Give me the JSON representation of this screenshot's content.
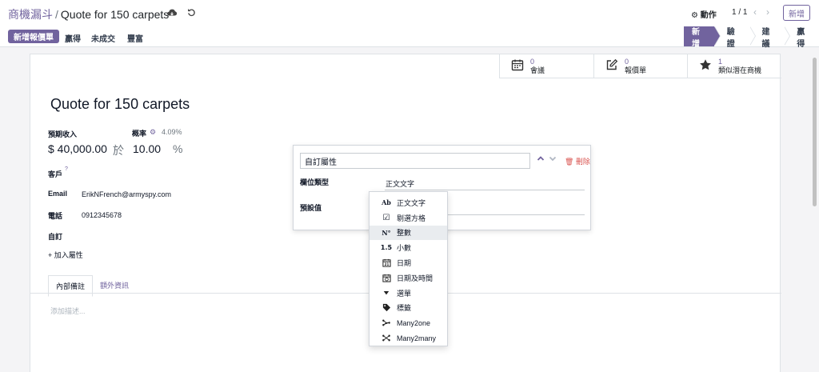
{
  "breadcrumb": {
    "parent": "商機漏斗",
    "separator": "/",
    "current": "Quote for 150 carpets"
  },
  "topbar": {
    "action": "⚙ 動作",
    "pager": "1 / 1",
    "new_label": "新增"
  },
  "control": {
    "new_quote": "新增報價單",
    "buttons": [
      "贏得",
      "未成交",
      "豐富"
    ],
    "stages": [
      "新增",
      "驗證",
      "建議",
      "贏得"
    ]
  },
  "smart_buttons": [
    {
      "value": "0",
      "label": "會議",
      "icon": "calendar-icon"
    },
    {
      "value": "0",
      "label": "報價單",
      "icon": "pencil-square-icon"
    },
    {
      "value": "1",
      "label": "類似潛在商機",
      "icon": "star-icon"
    }
  ],
  "record": {
    "title": "Quote for 150 carpets",
    "expected_revenue_label": "預期收入",
    "expected_revenue": "$ 40,000.00",
    "at_label": "於",
    "probability_label": "概率",
    "probability_auto": "4.09%",
    "probability": "10.00",
    "percent": "%",
    "customer_label": "客戶",
    "customer_help": "?",
    "email_label": "Email",
    "email": "ErikNFrench@armyspy.com",
    "phone_label": "電話",
    "phone": "0912345678",
    "custom_label": "自訂",
    "add_property": "+ 加入屬性"
  },
  "tabs": [
    "內部備註",
    "額外資訊"
  ],
  "notes_placeholder": "添加描述...",
  "popover": {
    "property_name": "自訂屬性",
    "delete_label": "🗑 刪除",
    "field_type_label": "欄位類型",
    "field_type_value": "正文文字",
    "default_label": "預設值"
  },
  "dropdown": [
    {
      "icon": "Ab",
      "label": "正文文字"
    },
    {
      "icon": "☑",
      "label": "剔選方格"
    },
    {
      "icon": "N°",
      "label": "整數",
      "highlighted": true
    },
    {
      "icon": "1.5",
      "label": "小數"
    },
    {
      "icon": "📅",
      "label": "日期"
    },
    {
      "icon": "🗓",
      "label": "日期及時間"
    },
    {
      "icon": "▼",
      "label": "選單"
    },
    {
      "icon": "🏷",
      "label": "標籤"
    },
    {
      "icon": "⊶",
      "label": "Many2one"
    },
    {
      "icon": "⋈",
      "label": "Many2many"
    }
  ]
}
